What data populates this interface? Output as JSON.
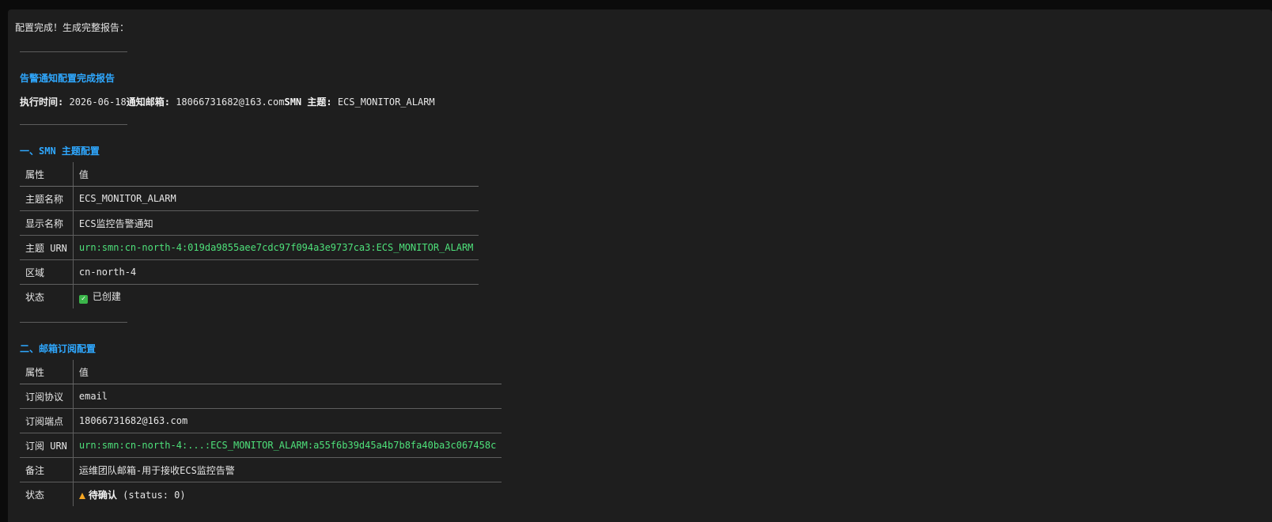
{
  "intro": "配置完成！生成完整报告：",
  "report": {
    "title": "告警通知配置完成报告",
    "meta": {
      "exec_time_label": "执行时间",
      "exec_time_value": "2026-06-18",
      "email_label": "通知邮箱",
      "email_value": "18066731682@163.com",
      "topic_label": "SMN 主题",
      "topic_value": "ECS_MONITOR_ALARM"
    }
  },
  "section1": {
    "title": "一、SMN 主题配置",
    "header": {
      "key": "属性",
      "value": "值"
    },
    "rows": [
      {
        "key": "主题名称",
        "value": "ECS_MONITOR_ALARM"
      },
      {
        "key": "显示名称",
        "value": "ECS监控告警通知"
      },
      {
        "key": "主题 URN",
        "value": "urn:smn:cn-north-4:019da9855aee7cdc97f094a3e9737ca3:ECS_MONITOR_ALARM"
      },
      {
        "key": "区域",
        "value": "cn-north-4"
      },
      {
        "key": "状态",
        "value": "已创建",
        "icon": "check-icon"
      }
    ]
  },
  "section2": {
    "title": "二、邮箱订阅配置",
    "header": {
      "key": "属性",
      "value": "值"
    },
    "rows": [
      {
        "key": "订阅协议",
        "value": "email"
      },
      {
        "key": "订阅端点",
        "value": "18066731682@163.com"
      },
      {
        "key": "订阅 URN",
        "value": "urn:smn:cn-north-4:...:ECS_MONITOR_ALARM:a55f6b39d45a4b7b8fa40ba3c067458c"
      },
      {
        "key": "备注",
        "value": "运维团队邮箱-用于接收ECS监控告警"
      },
      {
        "key": "状态",
        "value": "待确认",
        "suffix": "(status: 0)",
        "icon": "warning-icon"
      }
    ]
  },
  "colors": {
    "background": "#1e1e1e",
    "heading": "#2fa8ff",
    "urn": "#4ee07a",
    "text": "#e6e6e6"
  }
}
